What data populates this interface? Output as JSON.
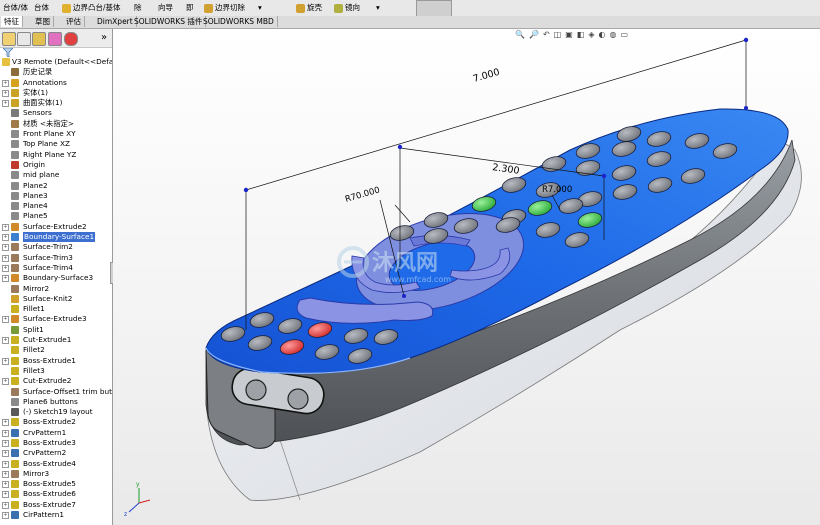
{
  "toolbar": {
    "items": [
      "台体/体",
      "台体",
      "边界凸台/基体",
      "除",
      "向导",
      "即",
      "边界切除",
      "旋壳",
      "镜向"
    ]
  },
  "tabs": [
    {
      "label": "特征",
      "active": true
    },
    {
      "label": "草图",
      "active": false
    },
    {
      "label": "评估",
      "active": false
    },
    {
      "label": "DimXpert",
      "active": false
    },
    {
      "label": "SOLIDWORKS 插件",
      "active": false
    },
    {
      "label": "SOLIDWORKS MBD",
      "active": false
    }
  ],
  "panel": {
    "collapse_glyph": "»"
  },
  "tree": {
    "root": "V3 Remote  (Default<<Defa",
    "items": [
      {
        "label": "历史记录",
        "icon": "history-icon",
        "color": "#8a6d3b",
        "exp": false
      },
      {
        "label": "Annotations",
        "icon": "annotations-icon",
        "color": "#d6a21e",
        "exp": true
      },
      {
        "label": "实体(1)",
        "icon": "solid-bodies-icon",
        "color": "#c9a227",
        "exp": true
      },
      {
        "label": "曲面实体(1)",
        "icon": "surface-bodies-icon",
        "color": "#c9a227",
        "exp": true
      },
      {
        "label": "Sensors",
        "icon": "sensors-icon",
        "color": "#7a7a7a",
        "exp": false
      },
      {
        "label": "材质 <未指定>",
        "icon": "material-icon",
        "color": "#a07a4a",
        "exp": false
      },
      {
        "label": "Front Plane XY",
        "icon": "plane-icon",
        "color": "#8a8a8a",
        "exp": false
      },
      {
        "label": "Top Plane XZ",
        "icon": "plane-icon",
        "color": "#8a8a8a",
        "exp": false
      },
      {
        "label": "Right Plane YZ",
        "icon": "plane-icon",
        "color": "#8a8a8a",
        "exp": false
      },
      {
        "label": "Origin",
        "icon": "origin-icon",
        "color": "#c0392b",
        "exp": false
      },
      {
        "label": "mid plane",
        "icon": "plane-icon",
        "color": "#8a8a8a",
        "exp": false
      },
      {
        "label": "Plane2",
        "icon": "plane-icon",
        "color": "#8a8a8a",
        "exp": false
      },
      {
        "label": "Plane3",
        "icon": "plane-icon",
        "color": "#8a8a8a",
        "exp": false
      },
      {
        "label": "Plane4",
        "icon": "plane-icon",
        "color": "#8a8a8a",
        "exp": false
      },
      {
        "label": "Plane5",
        "icon": "plane-icon",
        "color": "#8a8a8a",
        "exp": false
      },
      {
        "label": "Surface-Extrude2",
        "icon": "surface-extrude-icon",
        "color": "#d08a2a",
        "exp": true
      },
      {
        "label": "Boundary-Surface1",
        "icon": "boundary-surface-icon",
        "color": "#3a7fd0",
        "exp": true,
        "selected": true
      },
      {
        "label": "Surface-Trim2",
        "icon": "surface-trim-icon",
        "color": "#9a7a5a",
        "exp": true
      },
      {
        "label": "Surface-Trim3",
        "icon": "surface-trim-icon",
        "color": "#9a7a5a",
        "exp": true
      },
      {
        "label": "Surface-Trim4",
        "icon": "surface-trim-icon",
        "color": "#9a7a5a",
        "exp": true
      },
      {
        "label": "Boundary-Surface3",
        "icon": "boundary-surface-icon",
        "color": "#d08a2a",
        "exp": true
      },
      {
        "label": "Mirror2",
        "icon": "mirror-icon",
        "color": "#9a7a5a",
        "exp": false
      },
      {
        "label": "Surface-Knit2",
        "icon": "surface-knit-icon",
        "color": "#d0a02a",
        "exp": false
      },
      {
        "label": "Fillet1",
        "icon": "fillet-icon",
        "color": "#c9b020",
        "exp": false
      },
      {
        "label": "Surface-Extrude3",
        "icon": "surface-extrude-icon",
        "color": "#d08a2a",
        "exp": true
      },
      {
        "label": "Split1",
        "icon": "split-icon",
        "color": "#7a9a3a",
        "exp": false
      },
      {
        "label": "Cut-Extrude1",
        "icon": "cut-extrude-icon",
        "color": "#c9b020",
        "exp": true
      },
      {
        "label": "Fillet2",
        "icon": "fillet-icon",
        "color": "#c9b020",
        "exp": false
      },
      {
        "label": "Boss-Extrude1",
        "icon": "boss-extrude-icon",
        "color": "#c9b020",
        "exp": true
      },
      {
        "label": "Fillet3",
        "icon": "fillet-icon",
        "color": "#c9b020",
        "exp": false
      },
      {
        "label": "Cut-Extrude2",
        "icon": "cut-extrude-icon",
        "color": "#c9b020",
        "exp": true
      },
      {
        "label": "Surface-Offset1 trim but",
        "icon": "surface-offset-icon",
        "color": "#9a7a5a",
        "exp": false
      },
      {
        "label": "Plane6 buttons",
        "icon": "plane-icon",
        "color": "#8a8a8a",
        "exp": false
      },
      {
        "label": "(-) Sketch19 layout",
        "icon": "sketch-icon",
        "color": "#5a5a5a",
        "exp": false
      },
      {
        "label": "Boss-Extrude2",
        "icon": "boss-extrude-icon",
        "color": "#c9b020",
        "exp": true
      },
      {
        "label": "CrvPattern1",
        "icon": "curve-pattern-icon",
        "color": "#3a6fb0",
        "exp": true
      },
      {
        "label": "Boss-Extrude3",
        "icon": "boss-extrude-icon",
        "color": "#c9b020",
        "exp": true
      },
      {
        "label": "CrvPattern2",
        "icon": "curve-pattern-icon",
        "color": "#3a6fb0",
        "exp": true
      },
      {
        "label": "Boss-Extrude4",
        "icon": "boss-extrude-icon",
        "color": "#c9b020",
        "exp": true
      },
      {
        "label": "Mirror3",
        "icon": "mirror-icon",
        "color": "#9a7a5a",
        "exp": true
      },
      {
        "label": "Boss-Extrude5",
        "icon": "boss-extrude-icon",
        "color": "#c9b020",
        "exp": true
      },
      {
        "label": "Boss-Extrude6",
        "icon": "boss-extrude-icon",
        "color": "#c9b020",
        "exp": true
      },
      {
        "label": "Boss-Extrude7",
        "icon": "boss-extrude-icon",
        "color": "#c9b020",
        "exp": true
      },
      {
        "label": "CirPattern1",
        "icon": "circular-pattern-icon",
        "color": "#3a6fb0",
        "exp": true
      }
    ]
  },
  "dimensions": {
    "length": "7.000",
    "width": "2.300",
    "radius_large": "R70.000",
    "radius_small": "R7.000"
  },
  "watermark": {
    "title": "沐风网",
    "url": "www.mfcad.com"
  },
  "colors": {
    "top_face": "#1e6ae8",
    "body_gray": "#808488",
    "button_green": "#3ac84a",
    "button_red": "#e03838",
    "button_gray": "#8a8d92",
    "selection": "#3d6fd0"
  }
}
